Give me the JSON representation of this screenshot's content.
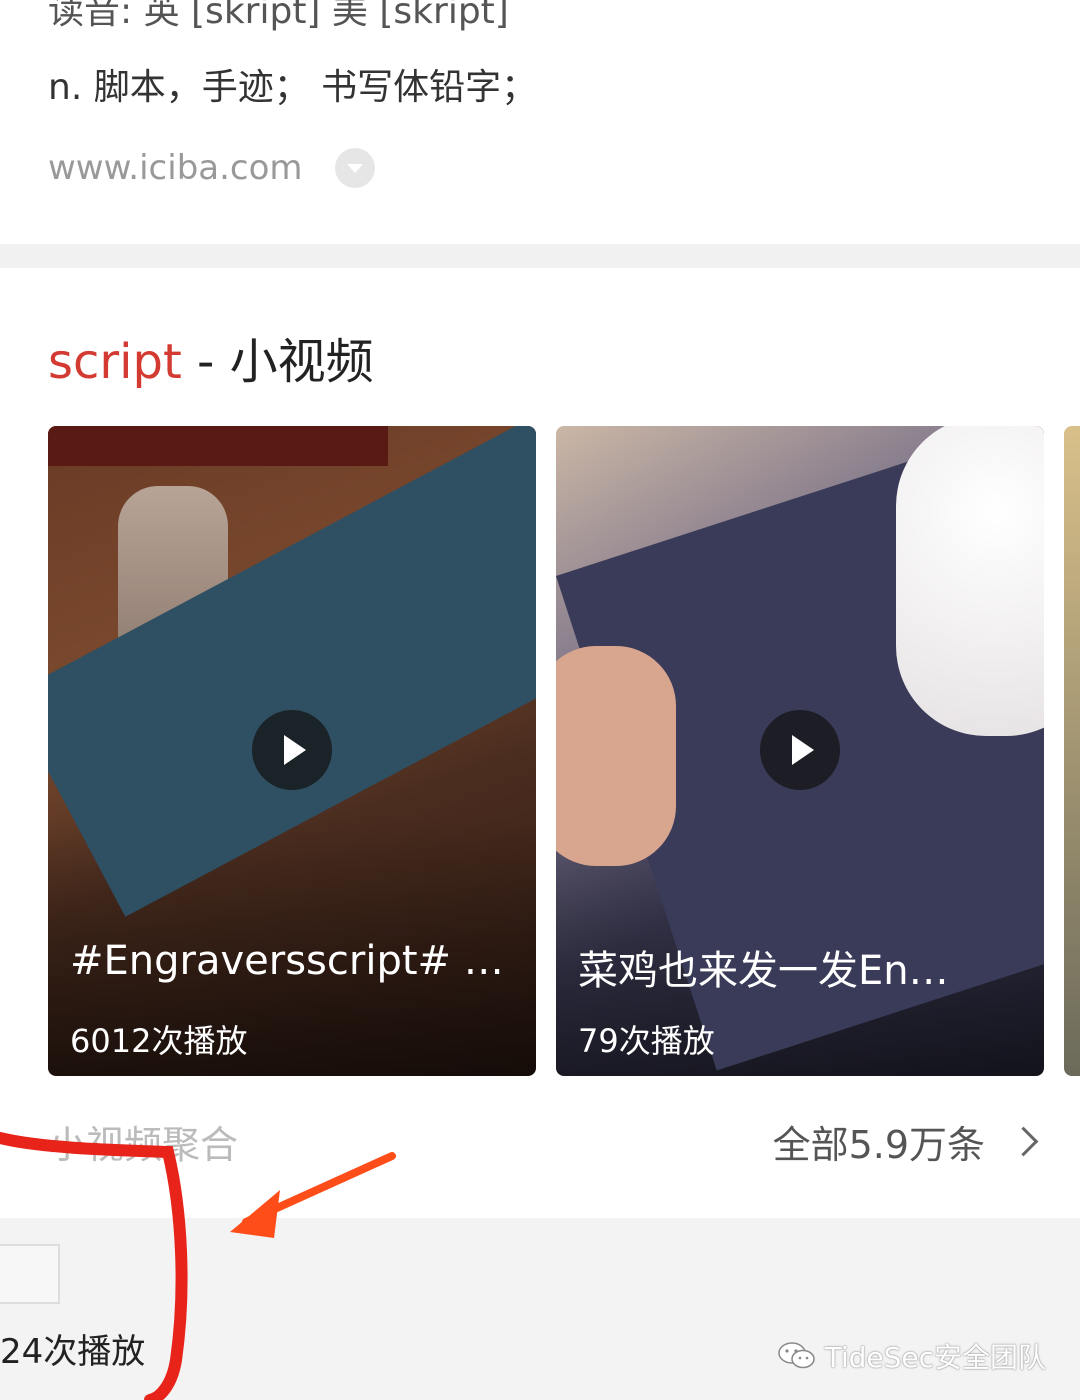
{
  "dict": {
    "pronunciation": "读音: 英 [skript] 美 [skript]",
    "definition": "n. 脚本，手迹； 书写体铅字；",
    "source": "www.iciba.com",
    "dropdown_icon": "chevron-down-icon"
  },
  "video_section": {
    "keyword": "script",
    "title_suffix": " - 小视频",
    "videos": [
      {
        "title": "#Engraversscript# …",
        "plays": "6012次播放"
      },
      {
        "title": "菜鸡也来发一发En…",
        "plays": "79次播放"
      }
    ],
    "aggregate_label": "小视频聚合",
    "all_label": "全部5.9万条"
  },
  "bottom": {
    "plays": "24次播放"
  },
  "watermark": {
    "text": "TideSec安全团队"
  },
  "colors": {
    "keyword": "#d33a32",
    "annotation": "#e8231a"
  }
}
